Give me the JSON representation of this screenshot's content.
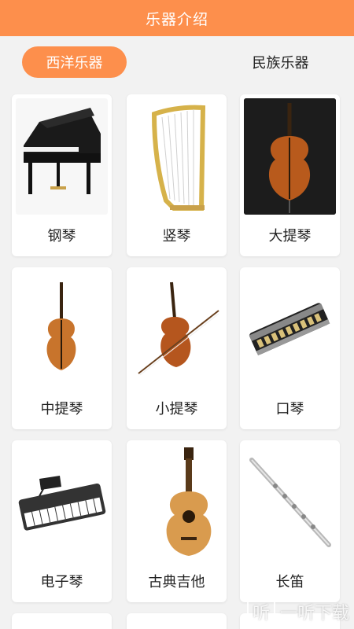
{
  "header": {
    "title": "乐器介绍"
  },
  "tabs": [
    {
      "label": "西洋乐器"
    },
    {
      "label": "民族乐器"
    }
  ],
  "instruments": [
    {
      "name": "钢琴",
      "icon": "piano-icon"
    },
    {
      "name": "竖琴",
      "icon": "harp-icon"
    },
    {
      "name": "大提琴",
      "icon": "cello-icon"
    },
    {
      "name": "中提琴",
      "icon": "viola-icon"
    },
    {
      "name": "小提琴",
      "icon": "violin-icon"
    },
    {
      "name": "口琴",
      "icon": "harmonica-icon"
    },
    {
      "name": "电子琴",
      "icon": "keyboard-icon"
    },
    {
      "name": "古典吉他",
      "icon": "guitar-icon"
    },
    {
      "name": "长笛",
      "icon": "flute-icon"
    }
  ],
  "watermark": {
    "text": "一听下载",
    "glyph": "听"
  },
  "colors": {
    "accent": "#fd8f4c",
    "background": "#f2f2f2"
  }
}
